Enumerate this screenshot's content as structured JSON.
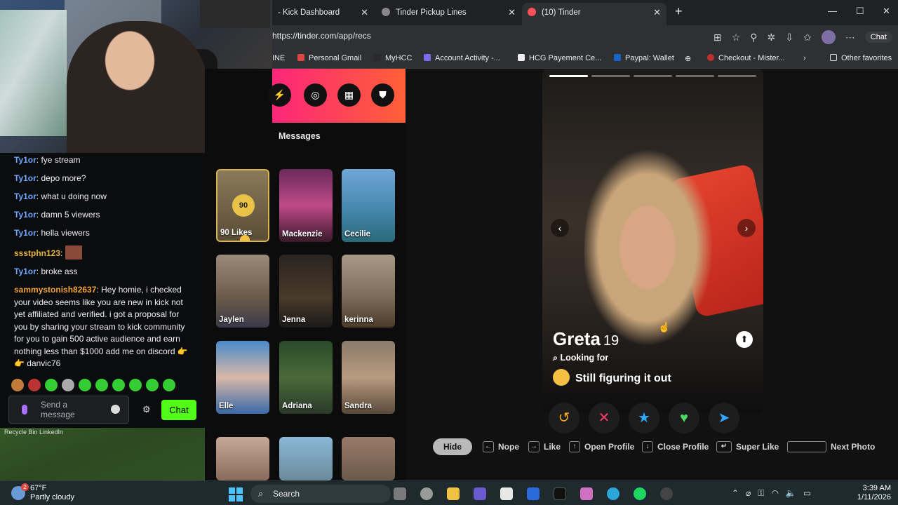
{
  "chat": {
    "messages": [
      {
        "user": "Ty1or",
        "text": " fye stream",
        "color": "blue"
      },
      {
        "user": "Ty1or",
        "text": " depo more?",
        "color": "blue"
      },
      {
        "user": "Ty1or",
        "text": " what u doing now",
        "color": "blue"
      },
      {
        "user": "Ty1or",
        "text": " damn 5 viewers",
        "color": "blue"
      },
      {
        "user": "Ty1or",
        "text": " hella viewers",
        "color": "blue"
      },
      {
        "user": "ssstphn123",
        "text": "",
        "color": "gold"
      },
      {
        "user": "Ty1or",
        "text": " broke ass",
        "color": "blue"
      },
      {
        "user": "sammystonish82637",
        "text": " Hey homie, i checked your video seems like you are new in kick not yet affiliated and verified. i got a proposal for you by sharing your stream to kick community for you to gain 500 active audience and earn nothing less than $1000 add me on discord 👉 👉  danvic76",
        "color": "orange"
      }
    ],
    "input_placeholder": "Send a message",
    "chat_button": "Chat",
    "desktop_labels": "Recycle Bin        LinkedIn"
  },
  "browser": {
    "tabs": [
      {
        "label": "- Kick Dashboard"
      },
      {
        "label": "Tinder Pickup Lines"
      },
      {
        "label": "(10) Tinder"
      }
    ],
    "url": "https://tinder.com/app/recs",
    "copilot_label": "Chat",
    "bookmarks": [
      "INE",
      "Personal Gmail",
      "MyHCC",
      "Account Activity -...",
      "HCG Payement Ce...",
      "Paypal: Wallet",
      "",
      "Checkout - Mister...",
      "Other favorites"
    ]
  },
  "tinder": {
    "messages_title": "Messages",
    "likes_count": "90",
    "likes_label": "90 Likes",
    "matches": [
      "Mackenzie",
      "Cecilie",
      "Jaylen",
      "Jenna",
      "kerinna",
      "Elle",
      "Adriana",
      "Sandra"
    ],
    "profile": {
      "name": "Greta",
      "age": "19",
      "looking_for_label": "Looking for",
      "looking_for_value": "Still figuring it out"
    },
    "shortcuts": {
      "hide": "Hide",
      "nope": "Nope",
      "like": "Like",
      "open_profile": "Open Profile",
      "close_profile": "Close Profile",
      "super_like": "Super Like",
      "next_photo": "Next Photo"
    },
    "colors": {
      "gradient_start": "#fd267a",
      "gradient_end": "#ff6036"
    }
  },
  "taskbar": {
    "weather_temp": "67°F",
    "weather_desc": "Partly cloudy",
    "weather_badge": "2",
    "search": "Search",
    "time": "3:39 AM",
    "date": "1/11/2026"
  }
}
